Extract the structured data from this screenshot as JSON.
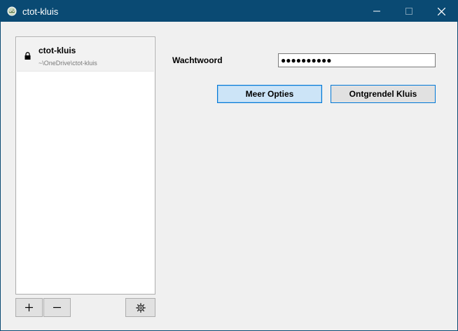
{
  "window": {
    "title": "ctot-kluis",
    "app_icon": "cryptomator-icon",
    "controls": [
      "minimize-icon",
      "maximize-icon",
      "close-icon"
    ]
  },
  "vault_list": {
    "items": [
      {
        "name": "ctot-kluis",
        "path": "~\\OneDrive\\ctot-kluis",
        "icon": "lock-icon",
        "selected": true
      }
    ]
  },
  "toolbar": {
    "add_label": "+",
    "remove_label": "−",
    "settings_icon": "gear-icon"
  },
  "unlock_form": {
    "password_label": "Wachtwoord",
    "password_value": "●●●●●●●●●●",
    "more_options_label": "Meer Opties",
    "unlock_label": "Ontgrendel Kluis"
  },
  "colors": {
    "titlebar": "#0a4a73",
    "accent": "#0078d7",
    "focused_button": "#cce4f7"
  }
}
